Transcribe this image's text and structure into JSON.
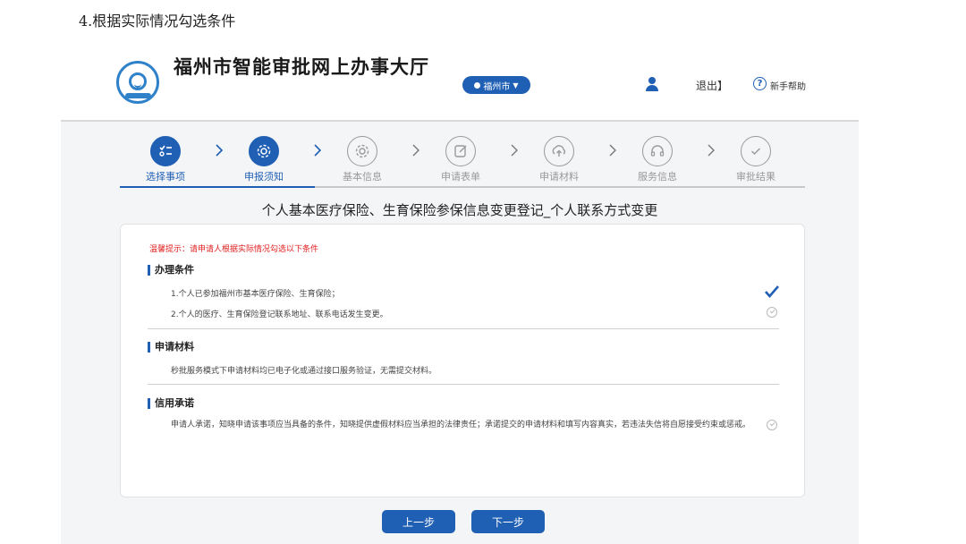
{
  "doc_heading": "4.根据实际情况勾选条件",
  "header": {
    "site_title": "福州市智能审批网上办事大厅",
    "city": "福州市",
    "logout": "退出】",
    "help": "新手帮助"
  },
  "steps": [
    {
      "label": "选择事项",
      "state": "active",
      "icon": "list-icon"
    },
    {
      "label": "申报须知",
      "state": "active",
      "icon": "gear-icon"
    },
    {
      "label": "基本信息",
      "state": "inactive",
      "icon": "gear-icon"
    },
    {
      "label": "申请表单",
      "state": "inactive",
      "icon": "edit-icon"
    },
    {
      "label": "申请材料",
      "state": "inactive",
      "icon": "upload-icon"
    },
    {
      "label": "服务信息",
      "state": "inactive",
      "icon": "headset-icon"
    },
    {
      "label": "审批结果",
      "state": "inactive",
      "icon": "check-circle-icon"
    }
  ],
  "item_title": "个人基本医疗保险、生育保险参保信息变更登记_个人联系方式变更",
  "card": {
    "tip": "温馨提示：请申请人根据实际情况勾选以下条件",
    "conditions_title": "办理条件",
    "conditions": [
      {
        "text": "1.个人已参加福州市基本医疗保险、生育保险；",
        "checked": true
      },
      {
        "text": "2.个人的医疗、生育保险登记联系地址、联系电话发生变更。",
        "checked": false
      }
    ],
    "materials_title": "申请材料",
    "materials_text": "秒批服务模式下申请材料均已电子化或通过接口服务验证，无需提交材料。",
    "promise_title": "信用承诺",
    "promise_text": "申请人承诺，知晓申请该事项应当具备的条件，知晓提供虚假材料应当承担的法律责任；承诺提交的申请材料和填写内容真实，若违法失信将自愿接受约束或惩戒。"
  },
  "buttons": {
    "prev": "上一步",
    "next": "下一步"
  },
  "colors": {
    "primary": "#1f5fb4",
    "tip": "#e02020"
  }
}
